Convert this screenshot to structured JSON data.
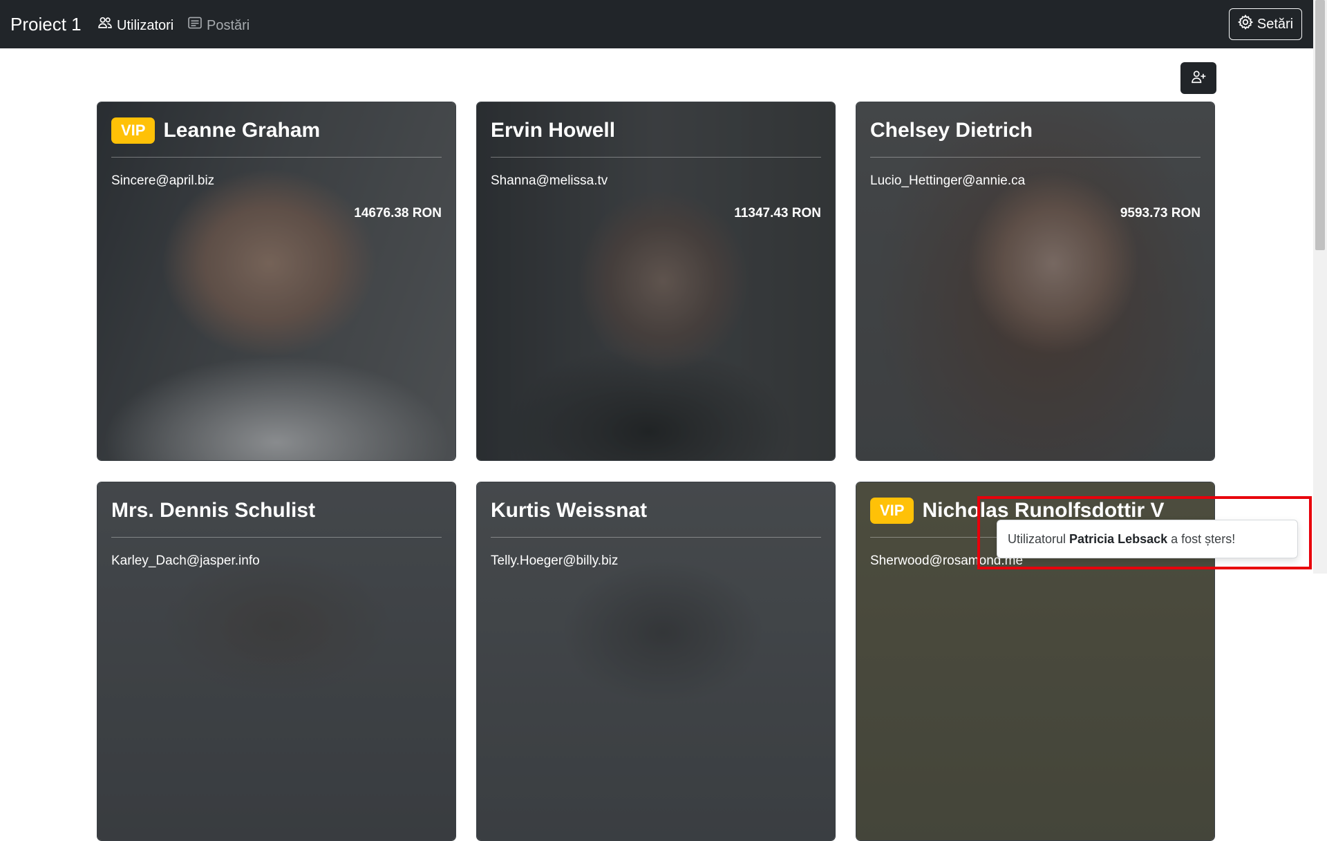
{
  "navbar": {
    "brand": "Proiect 1",
    "links": [
      {
        "label": "Utilizatori",
        "icon": "users-icon",
        "active": true
      },
      {
        "label": "Postări",
        "icon": "posts-icon",
        "active": false
      }
    ],
    "settings_label": "Setări"
  },
  "add_user_icon": "person-plus-icon",
  "cards": [
    {
      "vip": "VIP",
      "name": "Leanne Graham",
      "email": "Sincere@april.biz",
      "amount": "14676.38 RON"
    },
    {
      "vip": "",
      "name": "Ervin Howell",
      "email": "Shanna@melissa.tv",
      "amount": "11347.43 RON"
    },
    {
      "vip": "",
      "name": "Chelsey Dietrich",
      "email": "Lucio_Hettinger@annie.ca",
      "amount": "9593.73 RON"
    },
    {
      "vip": "",
      "name": "Mrs. Dennis Schulist",
      "email": "Karley_Dach@jasper.info",
      "amount": ""
    },
    {
      "vip": "",
      "name": "Kurtis Weissnat",
      "email": "Telly.Hoeger@billy.biz",
      "amount": ""
    },
    {
      "vip": "VIP",
      "name": "Nicholas Runolfsdottir V",
      "email": "Sherwood@rosamond.me",
      "amount": ""
    }
  ],
  "toast": {
    "prefix": "Utilizatorul",
    "user": "Patricia Lebsack",
    "suffix": "a fost șters!"
  },
  "colors": {
    "navbar": "#212529",
    "vip_badge": "#ffc107",
    "highlight": "#e8000b"
  }
}
